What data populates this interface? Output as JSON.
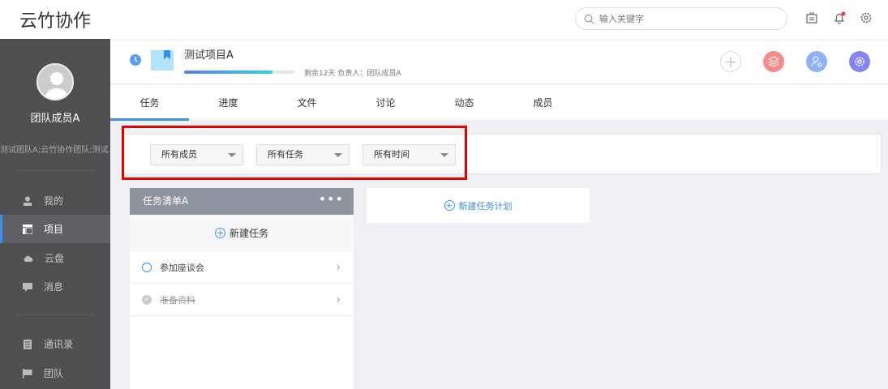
{
  "app": {
    "logo": "云竹协作",
    "search_placeholder": "输入关键字"
  },
  "sidebar": {
    "user_name": "团队成员A",
    "teams": "测试团队A;云竹协作团队;测试...",
    "items": [
      {
        "label": "我的"
      },
      {
        "label": "项目"
      },
      {
        "label": "云盘"
      },
      {
        "label": "消息"
      },
      {
        "label": "通讯录"
      },
      {
        "label": "团队"
      }
    ]
  },
  "project": {
    "title": "测试项目A",
    "progress_percent": 80,
    "meta": "剩余12天 负责人：团队成员A"
  },
  "tabs": [
    {
      "label": "任务"
    },
    {
      "label": "进度"
    },
    {
      "label": "文件"
    },
    {
      "label": "讨论"
    },
    {
      "label": "动态"
    },
    {
      "label": "成员"
    }
  ],
  "filters": [
    {
      "value": "所有成员"
    },
    {
      "value": "所有任务"
    },
    {
      "value": "所有时间"
    }
  ],
  "tasklist": {
    "title": "任务清单A",
    "new_task": "新建任务",
    "tasks": [
      {
        "name": "参加座谈会",
        "done": false
      },
      {
        "name": "准备资料",
        "done": true
      }
    ]
  },
  "new_plan": "新建任务计划",
  "colors": {
    "accent": "#3b8fe8",
    "highlight": "#e60000"
  }
}
